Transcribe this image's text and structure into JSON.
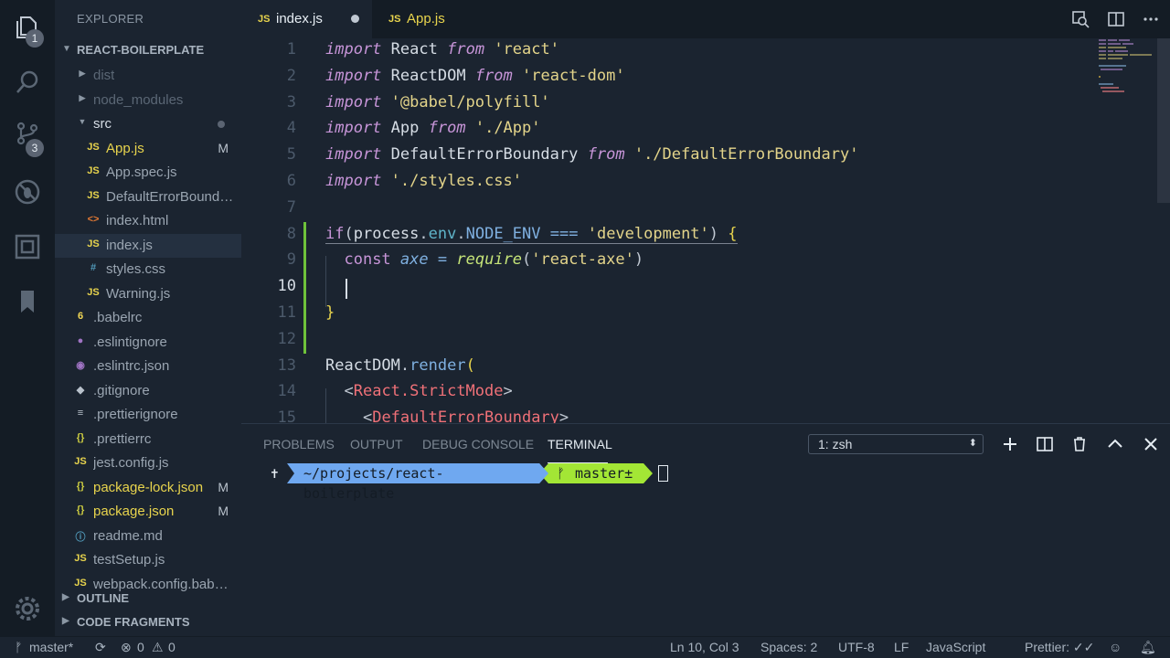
{
  "activity_bar": {
    "explorer_badge": "1",
    "scm_badge": "3"
  },
  "sidebar": {
    "title": "EXPLORER",
    "project": "REACT-BOILERPLATE",
    "items": [
      {
        "label": "dist",
        "icon": "folder-chevron",
        "dim": true
      },
      {
        "label": "node_modules",
        "icon": "folder-chevron",
        "dim": true
      },
      {
        "label": "src",
        "icon": "folder-chevron-open",
        "color": "#d6dde5"
      },
      {
        "label": "App.js",
        "icon": "JS",
        "badge": "M",
        "color": "#e8d44d"
      },
      {
        "label": "App.spec.js",
        "icon": "JS"
      },
      {
        "label": "DefaultErrorBoundary.js",
        "icon": "JS"
      },
      {
        "label": "index.html",
        "icon": "<>"
      },
      {
        "label": "index.js",
        "icon": "JS"
      },
      {
        "label": "styles.css",
        "icon": "#"
      },
      {
        "label": "Warning.js",
        "icon": "JS"
      },
      {
        "label": ".babelrc",
        "icon": "6"
      },
      {
        "label": ".eslintignore",
        "icon": "●"
      },
      {
        "label": ".eslintrc.json",
        "icon": "◉"
      },
      {
        "label": ".gitignore",
        "icon": "◆"
      },
      {
        "label": ".prettierignore",
        "icon": "≡"
      },
      {
        "label": ".prettierrc",
        "icon": "{}"
      },
      {
        "label": "jest.config.js",
        "icon": "JS"
      },
      {
        "label": "package-lock.json",
        "icon": "{}",
        "badge": "M",
        "color": "#e8d44d"
      },
      {
        "label": "package.json",
        "icon": "{}",
        "badge": "M",
        "color": "#e8d44d"
      },
      {
        "label": "readme.md",
        "icon": "ⓘ"
      },
      {
        "label": "testSetup.js",
        "icon": "JS"
      },
      {
        "label": "webpack.config.babel.js",
        "icon": "JS"
      }
    ],
    "outline_label": "OUTLINE",
    "fragments_label": "CODE FRAGMENTS"
  },
  "tabs": [
    {
      "label": "index.js",
      "icon": "JS",
      "active": true,
      "dirty": true
    },
    {
      "label": "App.js",
      "icon": "JS",
      "active": false
    }
  ],
  "editor": {
    "line_numbers": [
      "1",
      "2",
      "3",
      "4",
      "5",
      "6",
      "7",
      "8",
      "9",
      "10",
      "11",
      "12",
      "13",
      "14",
      "15"
    ],
    "current_line": "10"
  },
  "panel": {
    "tabs": [
      "PROBLEMS",
      "OUTPUT",
      "DEBUG CONSOLE",
      "TERMINAL"
    ],
    "active_tab": "TERMINAL",
    "terminal_select": "1: zsh",
    "prompt_symbol": "✝",
    "prompt_path": "~/projects/react-boilerplate",
    "prompt_branch": "master±"
  },
  "status": {
    "branch": "master*",
    "errors": "0",
    "warnings": "0",
    "position": "Ln 10, Col 3",
    "spaces": "Spaces: 2",
    "encoding": "UTF-8",
    "eol": "LF",
    "language": "JavaScript",
    "formatter": "Prettier: ✓✓"
  },
  "colors": {
    "accent_blue": "#6fa8f0",
    "accent_green": "#a3e635",
    "git_modified": "#6fc33a"
  }
}
